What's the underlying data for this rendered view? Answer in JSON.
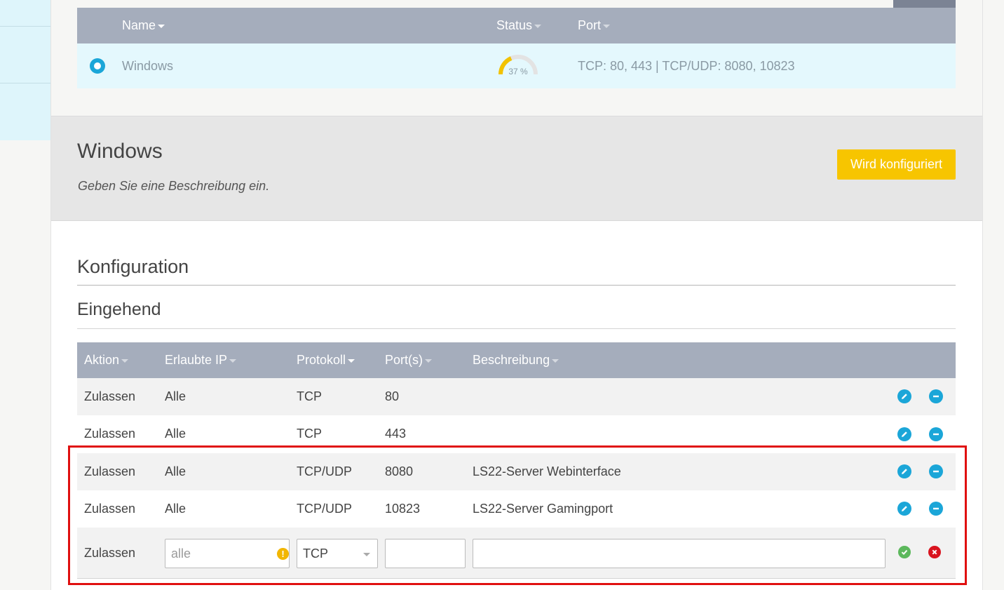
{
  "server_table": {
    "columns": [
      "Name",
      "Status",
      "Port"
    ],
    "row": {
      "name": "Windows",
      "status_percent": 37,
      "status_text": "37 %",
      "ports": "TCP: 80, 443 | TCP/UDP: 8080, 10823"
    }
  },
  "server_info": {
    "title": "Windows",
    "description": "Geben Sie eine Beschreibung ein.",
    "status_button": "Wird konfiguriert"
  },
  "configuration": {
    "heading": "Konfiguration",
    "incoming_heading": "Eingehend",
    "columns": [
      "Aktion",
      "Erlaubte IP",
      "Protokoll",
      "Port(s)",
      "Beschreibung"
    ],
    "rules": [
      {
        "action": "Zulassen",
        "ip": "Alle",
        "protocol": "TCP",
        "ports": "80",
        "description": ""
      },
      {
        "action": "Zulassen",
        "ip": "Alle",
        "protocol": "TCP",
        "ports": "443",
        "description": ""
      },
      {
        "action": "Zulassen",
        "ip": "Alle",
        "protocol": "TCP/UDP",
        "ports": "8080",
        "description": "LS22-Server Webinterface"
      },
      {
        "action": "Zulassen",
        "ip": "Alle",
        "protocol": "TCP/UDP",
        "ports": "10823",
        "description": "LS22-Server Gamingport"
      }
    ],
    "new_rule": {
      "action": "Zulassen",
      "ip_placeholder": "alle",
      "ip_value": "",
      "protocol": "TCP",
      "ports_value": "",
      "description_value": "",
      "warning_icon": "exclamation-icon"
    }
  },
  "colors": {
    "header_bg": "#a5adbc",
    "accent_blue": "#1ba6d8",
    "status_yellow": "#f7c500",
    "highlight_red": "#e01010",
    "confirm_green": "#5cb85c",
    "cancel_red": "#d9141f"
  }
}
